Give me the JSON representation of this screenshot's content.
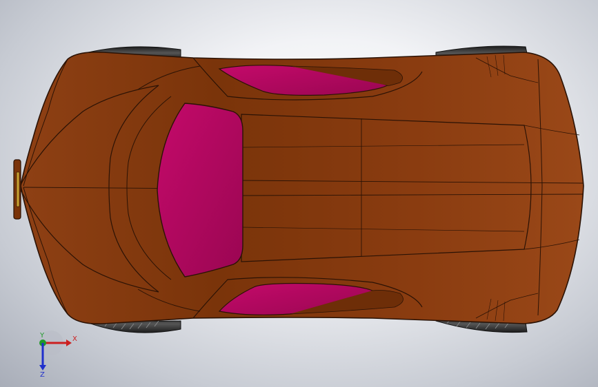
{
  "viewport": {
    "background_center": "#ffffff",
    "background_edge": "#a8adb8"
  },
  "model": {
    "body_color": "#8a3e10",
    "body_dark": "#6e2e08",
    "glass_color": "#b0085e",
    "tire_color": "#3a3a3a",
    "edge_color": "#2a1205"
  },
  "triad": {
    "x_label": "X",
    "y_label": "Y",
    "z_label": "Z",
    "x_color": "#cc1f1f",
    "y_color": "#1f9a2a",
    "z_color": "#1f2fcc"
  }
}
